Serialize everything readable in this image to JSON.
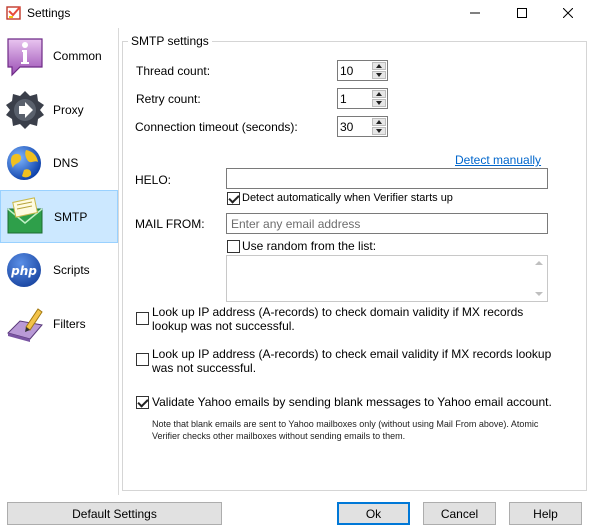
{
  "window": {
    "title": "Settings"
  },
  "sidebar": {
    "items": [
      {
        "label": "Common",
        "icon": "info-icon"
      },
      {
        "label": "Proxy",
        "icon": "proxy-arrow-icon"
      },
      {
        "label": "DNS",
        "icon": "globe-icon"
      },
      {
        "label": "SMTP",
        "icon": "envelope-icon",
        "selected": true
      },
      {
        "label": "Scripts",
        "icon": "php-icon"
      },
      {
        "label": "Filters",
        "icon": "filter-pencil-icon"
      }
    ]
  },
  "smtp": {
    "group_title": "SMTP settings",
    "thread_count_label": "Thread count:",
    "thread_count_value": "10",
    "retry_count_label": "Retry count:",
    "retry_count_value": "1",
    "timeout_label": "Connection timeout (seconds):",
    "timeout_value": "30",
    "detect_manually_link": "Detect manually",
    "helo_label": "HELO:",
    "helo_value": "",
    "detect_auto_label": "Detect automatically when Verifier starts up",
    "detect_auto_checked": true,
    "mail_from_label": "MAIL FROM:",
    "mail_from_placeholder": "Enter any email address",
    "use_random_label": "Use random from the list:",
    "use_random_checked": false,
    "lookup_domain_label_1": "Look up IP address (A-records) to check domain validity if MX records",
    "lookup_domain_label_2": "lookup was not successful.",
    "lookup_domain_checked": false,
    "lookup_email_label_1": "Look up IP address (A-records) to check email validity if MX records lookup",
    "lookup_email_label_2": "was not successful.",
    "lookup_email_checked": false,
    "validate_yahoo_label": "Validate Yahoo emails by sending blank messages to Yahoo email account.",
    "validate_yahoo_checked": true,
    "yahoo_note_1": "Note that blank emails are sent to Yahoo mailboxes only (without using Mail From above). Atomic",
    "yahoo_note_2": "Verifier checks other mailboxes without sending emails to them."
  },
  "buttons": {
    "default_settings": "Default Settings",
    "ok": "Ok",
    "cancel": "Cancel",
    "help": "Help"
  },
  "colors": {
    "selection_bg": "#cce8ff",
    "selection_border": "#99d1ff",
    "link": "#0066cc",
    "focus_border": "#0078d7"
  }
}
